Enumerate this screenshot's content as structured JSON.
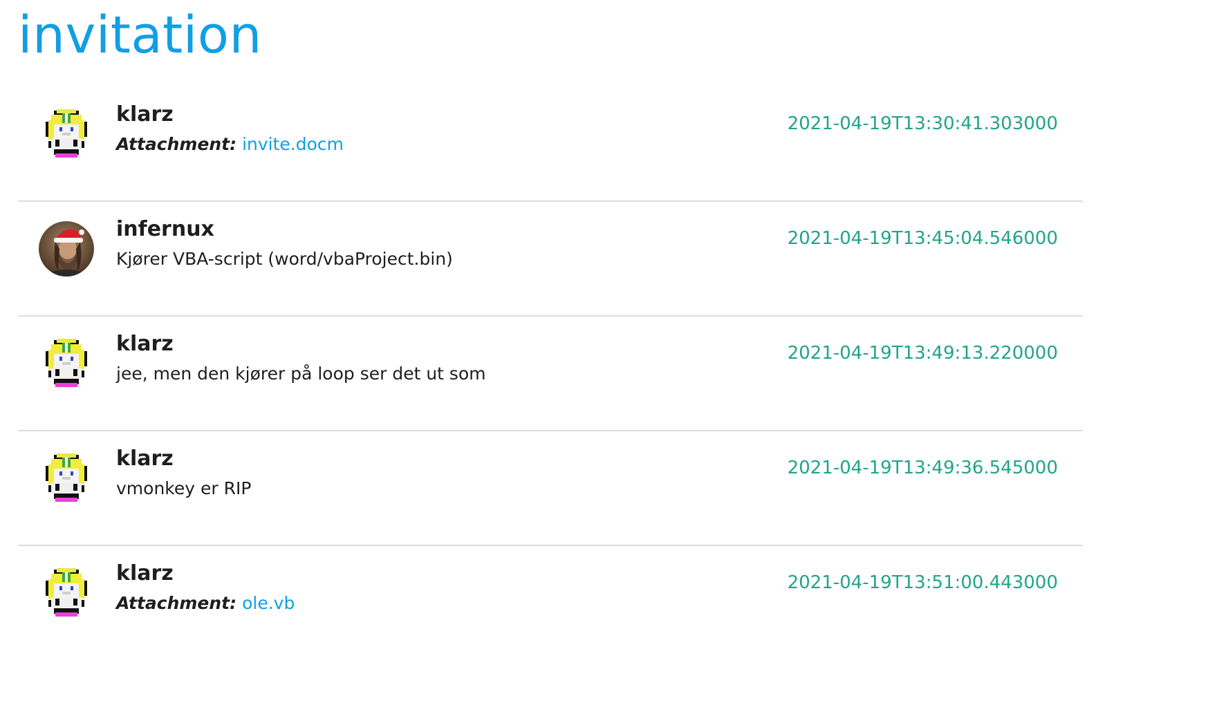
{
  "channel": {
    "title": "invitation"
  },
  "messages": [
    {
      "author": "klarz",
      "avatar_icon": "pixel-character-avatar",
      "type": "attachment",
      "attachment_label": "Attachment:",
      "attachment_name": "invite.docm",
      "timestamp": "2021-04-19T13:30:41.303000"
    },
    {
      "author": "infernux",
      "avatar_icon": "photo-avatar-santa-hat",
      "type": "text",
      "text": "Kjører VBA-script (word/vbaProject.bin)",
      "timestamp": "2021-04-19T13:45:04.546000"
    },
    {
      "author": "klarz",
      "avatar_icon": "pixel-character-avatar",
      "type": "text",
      "text": "jee, men den kjører på loop ser det ut som",
      "timestamp": "2021-04-19T13:49:13.220000"
    },
    {
      "author": "klarz",
      "avatar_icon": "pixel-character-avatar",
      "type": "text",
      "text": "vmonkey er RIP",
      "timestamp": "2021-04-19T13:49:36.545000"
    },
    {
      "author": "klarz",
      "avatar_icon": "pixel-character-avatar",
      "type": "attachment",
      "attachment_label": "Attachment:",
      "attachment_name": "ole.vb",
      "timestamp": "2021-04-19T13:51:00.443000"
    }
  ],
  "colors": {
    "title": "#119ee4",
    "link": "#119ee4",
    "timestamp": "#21a489",
    "divider": "#dcdcdc",
    "text": "#1e1e1e"
  }
}
